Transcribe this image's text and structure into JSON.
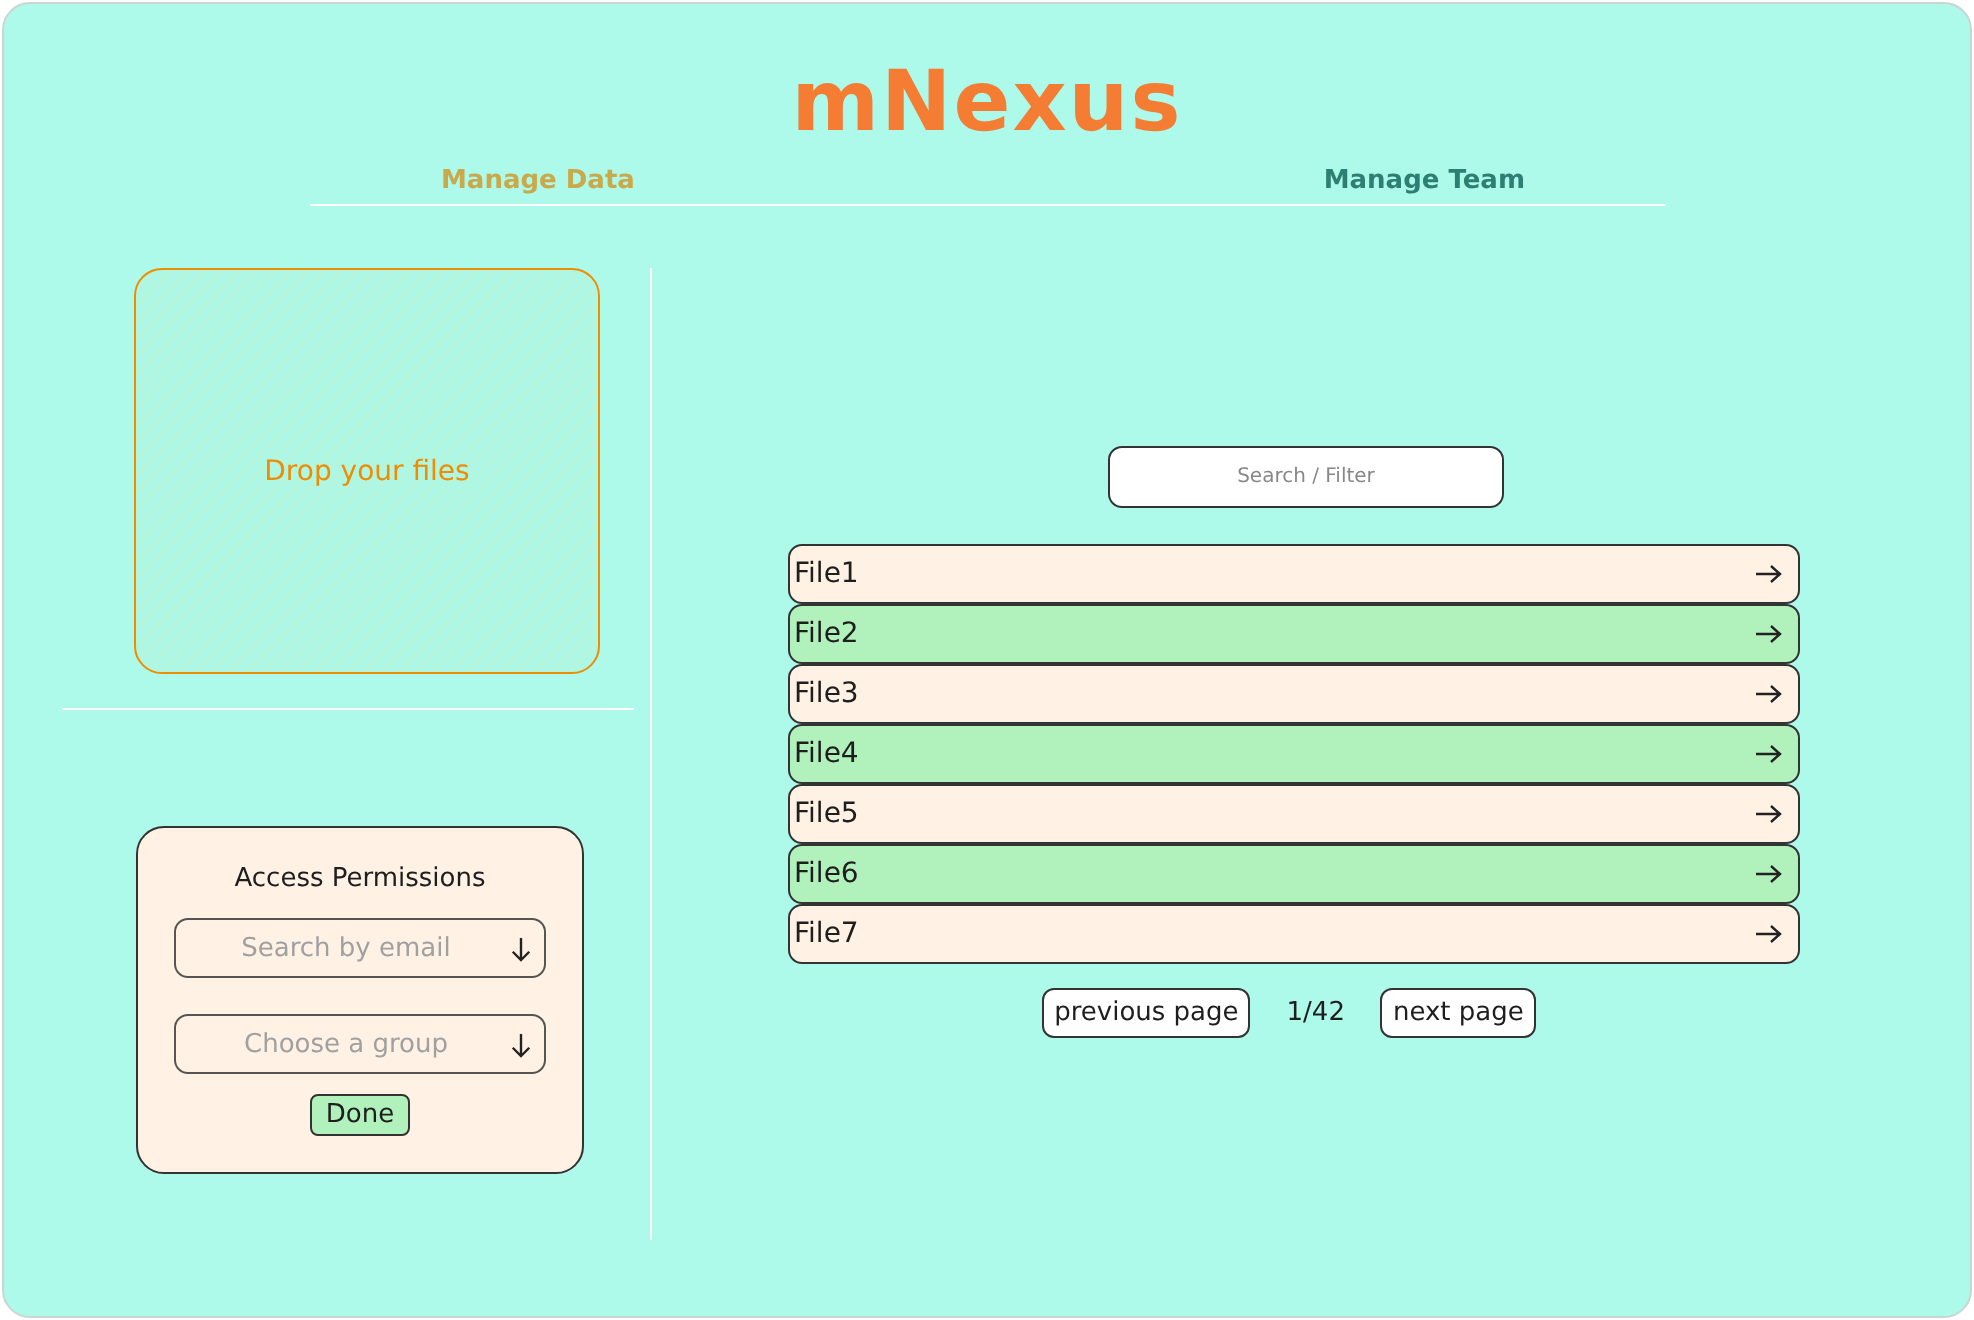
{
  "app": {
    "title": "mNexus"
  },
  "tabs": [
    {
      "label": "Manage Data",
      "selected": true
    },
    {
      "label": "Manage Team",
      "selected": false
    }
  ],
  "upload": {
    "label": "Drop your files"
  },
  "permissions": {
    "title": "Access Permissions",
    "email_field": {
      "placeholder": "Search by email"
    },
    "group_field": {
      "placeholder": "Choose a group"
    },
    "button": "Done"
  },
  "search": {
    "placeholder": "Search / Filter"
  },
  "files": [
    {
      "name": "File1",
      "color": "#fff2e5"
    },
    {
      "name": "File2",
      "color": "#b1f2bc"
    },
    {
      "name": "File3",
      "color": "#fff2e5"
    },
    {
      "name": "File4",
      "color": "#b1f2bc"
    },
    {
      "name": "File5",
      "color": "#fff2e5"
    },
    {
      "name": "File6",
      "color": "#b1f2bc"
    },
    {
      "name": "File7",
      "color": "#fff2e5"
    }
  ],
  "pagination": {
    "previous": "previous page",
    "page": "1/42",
    "next": "next page"
  }
}
